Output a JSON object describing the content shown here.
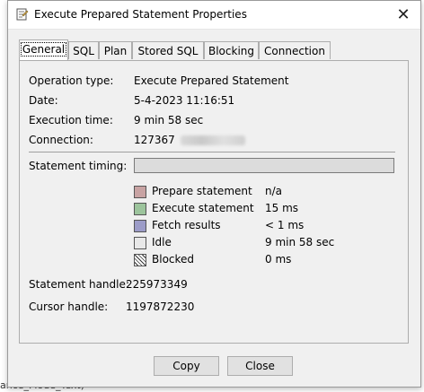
{
  "background": {
    "bottom_text": "ance_Mode_Text)"
  },
  "window": {
    "title": "Execute Prepared Statement Properties",
    "close_glyph": "✕"
  },
  "tabs": [
    {
      "label": "General",
      "active": true
    },
    {
      "label": "SQL",
      "active": false
    },
    {
      "label": "Plan",
      "active": false
    },
    {
      "label": "Stored SQL",
      "active": false
    },
    {
      "label": "Blocking",
      "active": false
    },
    {
      "label": "Connection",
      "active": false
    }
  ],
  "general": {
    "operation_type_label": "Operation type:",
    "operation_type_value": "Execute Prepared Statement",
    "date_label": "Date:",
    "date_value": "5-4-2023 11:16:51",
    "execution_time_label": "Execution time:",
    "execution_time_value": "9 min 58 sec",
    "connection_label": "Connection:",
    "connection_value": "127367",
    "statement_timing_label": "Statement timing:",
    "statement_handle_label": "Statement handle:",
    "statement_handle_value": "225973349",
    "cursor_handle_label": "Cursor handle:",
    "cursor_handle_value": "1197872230"
  },
  "legend": [
    {
      "name": "prepare",
      "label": "Prepare statement",
      "value": "n/a",
      "color": "#c8a3a3"
    },
    {
      "name": "execute",
      "label": "Execute statement",
      "value": "15 ms",
      "color": "#9cc49c"
    },
    {
      "name": "fetch",
      "label": "Fetch results",
      "value": "< 1 ms",
      "color": "#9c9cc8"
    },
    {
      "name": "idle",
      "label": "Idle",
      "value": "9 min 58 sec",
      "color": "#e8e8e8"
    },
    {
      "name": "blocked",
      "label": "Blocked",
      "value": "0 ms",
      "color": "hatched"
    }
  ],
  "buttons": {
    "copy_label": "Copy",
    "close_label": "Close"
  }
}
